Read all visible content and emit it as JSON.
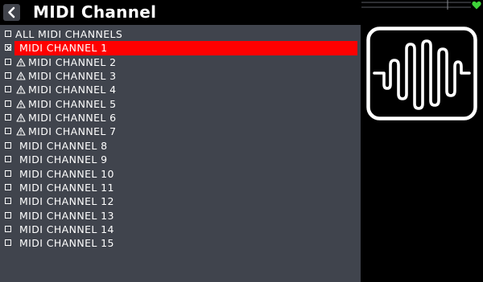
{
  "header": {
    "title": "MIDI Channel"
  },
  "list": {
    "rows": [
      {
        "label": "ALL MIDI CHANNELS",
        "checked": false,
        "warning": false,
        "selected": false
      },
      {
        "label": "MIDI CHANNEL 1",
        "checked": true,
        "warning": false,
        "selected": true
      },
      {
        "label": "MIDI CHANNEL 2",
        "checked": false,
        "warning": true,
        "selected": false
      },
      {
        "label": "MIDI CHANNEL 3",
        "checked": false,
        "warning": true,
        "selected": false
      },
      {
        "label": "MIDI CHANNEL 4",
        "checked": false,
        "warning": true,
        "selected": false
      },
      {
        "label": "MIDI CHANNEL 5",
        "checked": false,
        "warning": true,
        "selected": false
      },
      {
        "label": "MIDI CHANNEL 6",
        "checked": false,
        "warning": true,
        "selected": false
      },
      {
        "label": "MIDI CHANNEL 7",
        "checked": false,
        "warning": true,
        "selected": false
      },
      {
        "label": "MIDI CHANNEL 8",
        "checked": false,
        "warning": false,
        "selected": false
      },
      {
        "label": "MIDI CHANNEL 9",
        "checked": false,
        "warning": false,
        "selected": false
      },
      {
        "label": "MIDI CHANNEL 10",
        "checked": false,
        "warning": false,
        "selected": false
      },
      {
        "label": "MIDI CHANNEL 11",
        "checked": false,
        "warning": false,
        "selected": false
      },
      {
        "label": "MIDI CHANNEL 12",
        "checked": false,
        "warning": false,
        "selected": false
      },
      {
        "label": "MIDI CHANNEL 13",
        "checked": false,
        "warning": false,
        "selected": false
      },
      {
        "label": "MIDI CHANNEL 14",
        "checked": false,
        "warning": false,
        "selected": false
      },
      {
        "label": "MIDI CHANNEL 15",
        "checked": false,
        "warning": false,
        "selected": false
      }
    ]
  },
  "status": {
    "heart_icon": "heart-icon",
    "heart_color": "#3fd43a"
  },
  "preview": {
    "icon": "waveform-icon"
  },
  "colors": {
    "selection": "#ff0000",
    "panel": "#40444d",
    "background": "#000000"
  }
}
